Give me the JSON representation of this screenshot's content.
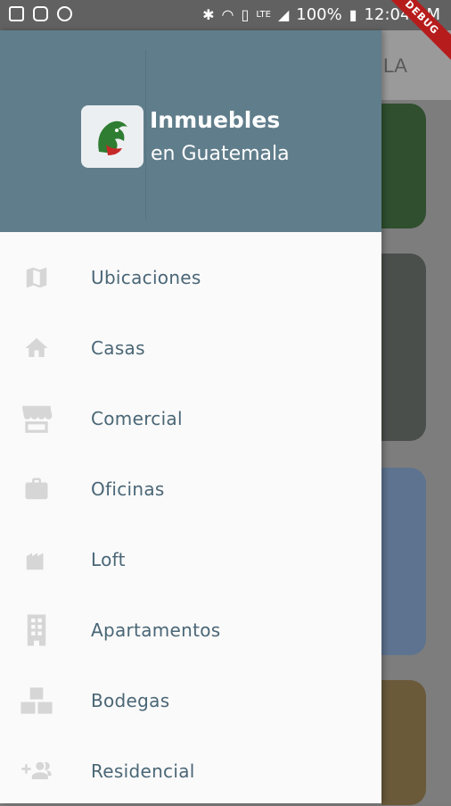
{
  "status_bar": {
    "battery": "100%",
    "time": "12:04 AM",
    "network": "LTE",
    "debug_label": "DEBUG"
  },
  "background": {
    "appbar_fragment": "LA"
  },
  "drawer": {
    "header": {
      "title": "Inmuebles",
      "subtitle": "en Guatemala"
    },
    "items": [
      {
        "label": "Ubicaciones",
        "icon": "map-icon"
      },
      {
        "label": "Casas",
        "icon": "home-icon"
      },
      {
        "label": "Comercial",
        "icon": "store-icon"
      },
      {
        "label": "Oficinas",
        "icon": "briefcase-icon"
      },
      {
        "label": "Loft",
        "icon": "building-icon"
      },
      {
        "label": "Apartamentos",
        "icon": "apartment-icon"
      },
      {
        "label": "Bodegas",
        "icon": "boxes-icon"
      },
      {
        "label": "Residencial",
        "icon": "group-add-icon"
      }
    ]
  },
  "colors": {
    "header": "#607d8b",
    "label": "#4a6676",
    "icon": "#d6d6d6",
    "drawer_bg": "#fafafa"
  }
}
